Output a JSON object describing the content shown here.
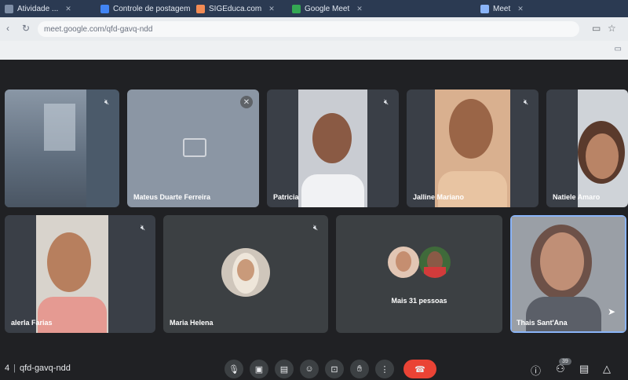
{
  "browser": {
    "tabs": [
      {
        "label": "Atividade ...",
        "favicon_color": "#7e8ea6"
      },
      {
        "label": "Controle de postagem",
        "favicon_color": "#4285f4"
      },
      {
        "label": "SIGEduca.com",
        "favicon_color": "#f28b54"
      },
      {
        "label": "Google Meet",
        "favicon_color": "#34a853"
      },
      {
        "label": "Meet",
        "favicon_color": "#8ab4f8"
      }
    ],
    "url": "meet.google.com/qfd-gavq-ndd"
  },
  "meeting": {
    "code": "qfd-gavq-ndd",
    "time_fragment": "4"
  },
  "participants": [
    {
      "name": "",
      "muted": true
    },
    {
      "name": "Mateus Duarte Ferreira",
      "muted": true,
      "camera": "off"
    },
    {
      "name": "Patricia",
      "muted": true
    },
    {
      "name": "Jalline Mariano",
      "muted": true
    },
    {
      "name": "Natiele Amaro",
      "muted": false
    },
    {
      "name": "alerla Farias",
      "muted": true
    },
    {
      "name": "Maria Helena",
      "muted": true,
      "camera": "off"
    },
    {
      "name": "Thais Sant'Ana",
      "muted": false,
      "active_speaker": true
    }
  ],
  "others_tile": {
    "label": "Mais 31 pessoas"
  },
  "participant_count": "39",
  "colors": {
    "accent": "#8ab4f8",
    "end_call": "#ea4335",
    "tile": "#3c4043",
    "background": "#202124"
  }
}
